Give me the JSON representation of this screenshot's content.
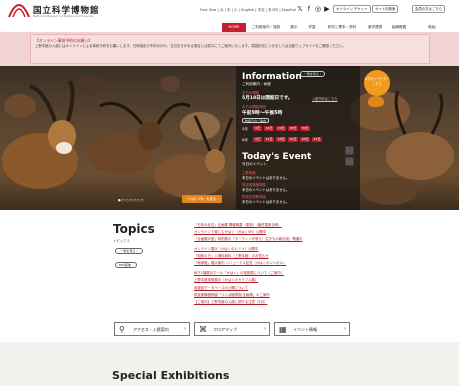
{
  "header": {
    "site_name": "国立科学博物館",
    "site_sub": "National Museum of Nature and Science",
    "util_links": "Font Size | 大 | 中 | 小 | English | 中文 | 한국어 | Español",
    "sns": [
      "𝕏",
      "f",
      "◎",
      "▶"
    ],
    "btn_online_ticket": "オンライン チケット",
    "btn_site_search": "サイト内検索",
    "btn_members": "会員の方はこちら"
  },
  "nav": {
    "items": [
      "HOME",
      "ご利用案内・施設",
      "展示",
      "学習",
      "研究と標本・資料",
      "産学連携",
      "組織概要",
      "取組"
    ]
  },
  "notice": {
    "title": "【オンライン事前予約のお願い】",
    "body": "上野本館の入館にはオンラインによる事前予約をお願いします。日時指定の予約のほか、当日空きがある場合には窓口にてご案内いたします。混雑状況につきましては当館ウェブサイトをご確認ください。"
  },
  "info": {
    "heading": "Information",
    "sub": "ご利用案内・休館",
    "list_btn": "一覧を見る ›",
    "today_label": "本日の開館",
    "today_text": "5月18日は開館日です。",
    "today_link": "入館予約はこちら",
    "hours_label": "本日の開館時間",
    "hours_text": "午前9時〜午後5時",
    "closed_label": "休館日のご案内",
    "month1": "5月",
    "month1_days": [
      "9日",
      "14日",
      "21日",
      "28日",
      "30日"
    ],
    "month2": "6月",
    "month2_days": [
      "4日",
      "11日",
      "18日",
      "25日",
      "26日",
      "27日"
    ],
    "mascot_text": "公式キャラクター こちら"
  },
  "event": {
    "heading": "Today's Event",
    "sub": "今日のイベント",
    "label1": "上野本館",
    "text1": "本日のイベントはありません。",
    "label2": "筑波実験植物園",
    "text2": "本日のイベントはありません。",
    "label3": "附属自然教育園",
    "text3": "本日のイベントはありません。"
  },
  "hero": {
    "slider_dots": "● ○ ○ ○ ○ ○ ○",
    "cta": "「かはくVR」を見る ›"
  },
  "topics": {
    "title": "Topics",
    "sub": "トピックス",
    "list_btn": "一覧を見る ›",
    "rss_btn": "RSS配信 ›",
    "items": [
      "「日本の化石」企画展 開催概要（更新）（最終更新日時）",
      "オンラインで楽しむかはく（かはくVR）公開中",
      "「企画展示室」特別展示「ダーウィンが来た！生きもの新伝説」開催中",
      "オンライン展示（かはくのヒミツ）公開中",
      "「昭和の日」入場料無料（上野本館）のお知らせ",
      "「地球館」展示案内 リニューアル記念（かはくのシンボル）",
      "地下1階展示ホール「かはく」の常設展について（ご案内）",
      "上野本館常設展示（かはくのカラフル展）",
      "収蔵品データベースの公開について",
      "筑波実験植物園「つくば植物園 企画展」のご案内",
      "【ご案内】上野本館の入館に関する注意（5月）"
    ]
  },
  "access": {
    "items": [
      {
        "icon": "⚲",
        "label": "アクセス・入館案内"
      },
      {
        "icon": "⌘",
        "label": "フロアマップ"
      },
      {
        "icon": "▦",
        "label": "イベント情報"
      }
    ]
  },
  "special": {
    "title": "Special Exhibitions"
  }
}
